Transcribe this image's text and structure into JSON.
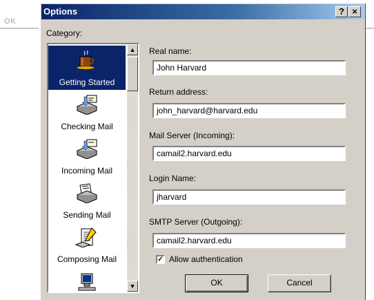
{
  "background": {
    "ok_text": "OK"
  },
  "dialog": {
    "title": "Options",
    "help_label": "?",
    "close_label": "×"
  },
  "category": {
    "label": "Category:",
    "items": [
      {
        "label": "Getting Started",
        "icon": "coffee-cup-icon",
        "selected": true
      },
      {
        "label": "Checking Mail",
        "icon": "check-mail-icon",
        "selected": false
      },
      {
        "label": "Incoming Mail",
        "icon": "incoming-mail-icon",
        "selected": false
      },
      {
        "label": "Sending Mail",
        "icon": "sending-mail-icon",
        "selected": false
      },
      {
        "label": "Composing Mail",
        "icon": "composing-mail-icon",
        "selected": false
      },
      {
        "label": "",
        "icon": "computer-icon",
        "selected": false
      }
    ]
  },
  "fields": {
    "real_name": {
      "label": "Real name:",
      "value": "John Harvard"
    },
    "return_address": {
      "label": "Return address:",
      "value": "john_harvard@harvard.edu"
    },
    "mail_server": {
      "label": "Mail Server (Incoming):",
      "value": "camail2.harvard.edu"
    },
    "login_name": {
      "label": "Login Name:",
      "value": "jharvard"
    },
    "smtp_server": {
      "label": "SMTP Server (Outgoing):",
      "value": "camail2.harvard.edu"
    }
  },
  "allow_auth": {
    "label": "Allow authentication",
    "checked": true,
    "mark": "✓"
  },
  "buttons": {
    "ok": "OK",
    "cancel": "Cancel"
  },
  "colors": {
    "title_bar": "#0a246a",
    "selection": "#0a246a",
    "face": "#d4d0c8"
  }
}
